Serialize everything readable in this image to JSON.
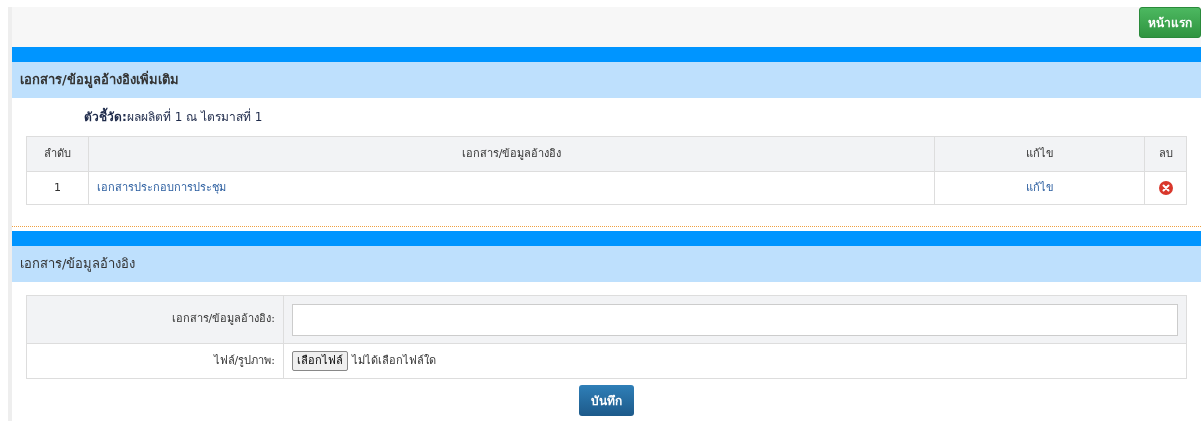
{
  "home_button": "หน้าแรก",
  "references_panel": {
    "title": "เอกสาร/ข้อมูลอ้างอิงเพิ่มเติม",
    "indicator": "**ตัวชี้วัด:**ผลผลิตที่ 1 ณ ไตรมาสที่ 1",
    "table": {
      "columns": [
        "ลำดับ",
        "เอกสาร/ข้อมูลอ้างอิง",
        "แก้ไข",
        "ลบ"
      ],
      "rows": [
        {
          "number": "1",
          "document": "เอกสารประกอบการประชุม",
          "edit": "แก้ไข"
        }
      ]
    }
  },
  "form_panel": {
    "title": "เอกสาร/ข้อมูลอ้างอิง",
    "fields": [
      {
        "kind": "text",
        "label": "เอกสาร/ข้อมูลอ้างอิง:"
      },
      {
        "kind": "file",
        "label": "ไฟล์/รูปภาพ:",
        "button": "เลือกไฟล์",
        "status": "ไม่ได้เลือกไฟล์ใด"
      }
    ],
    "save_button": "บันทึก"
  }
}
